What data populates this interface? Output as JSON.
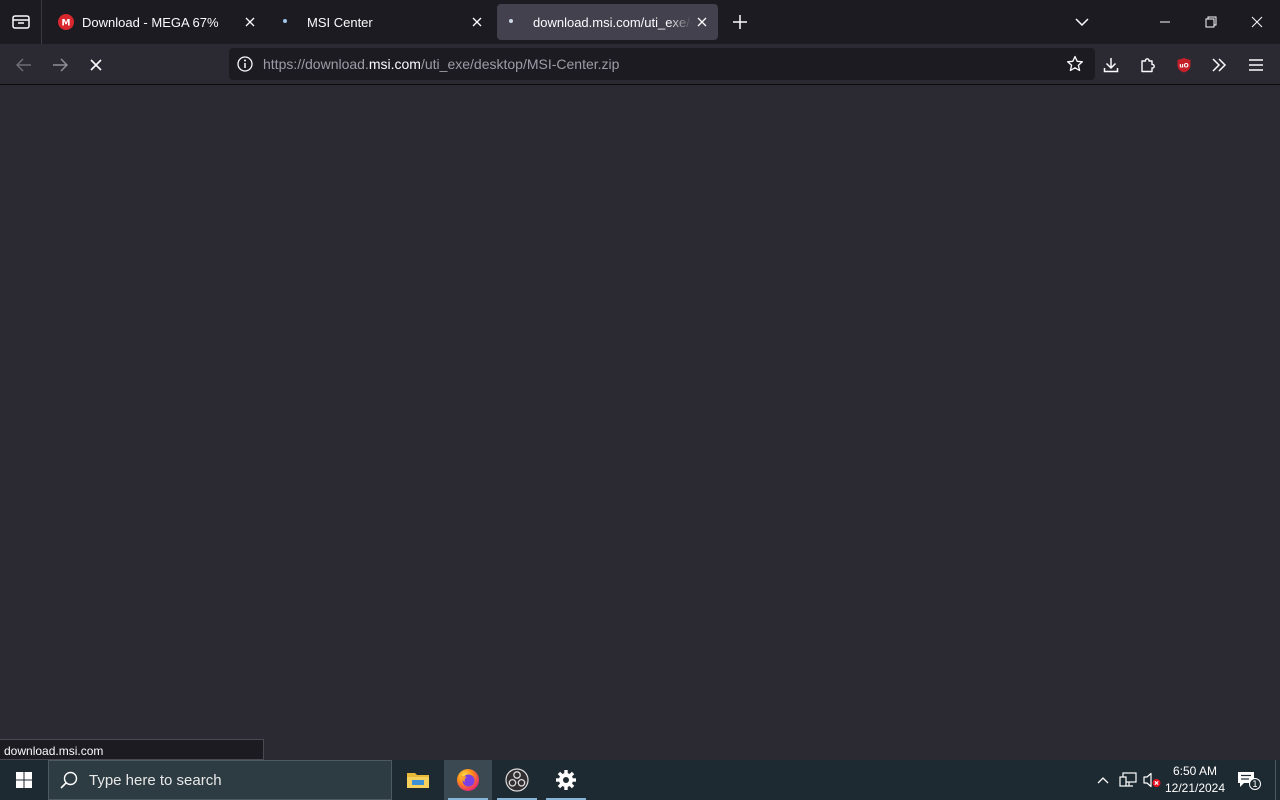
{
  "tabs": [
    {
      "title": "Download - MEGA 67%",
      "favicon": "mega-logo-icon",
      "favicon_color": "#d9272e"
    },
    {
      "title": "MSI Center",
      "favicon": "loading-dot-icon"
    },
    {
      "title": "download.msi.com/uti_exe/desktop/MSI-Center.zip",
      "favicon": "loading-dot-icon",
      "active": true
    }
  ],
  "navbar": {
    "url_prefix": "https://download.",
    "url_host": "msi.com",
    "url_path": "/uti_exe/desktop/MSI-Center.zip"
  },
  "extensions": {
    "ublock_label": "uO",
    "ublock_color": "#800000"
  },
  "status_text": "download.msi.com",
  "taskbar": {
    "search_placeholder": "Type here to search",
    "apps": [
      "file-explorer-icon",
      "firefox-icon",
      "obs-studio-icon",
      "settings-gear-icon"
    ],
    "time": "6:50 AM",
    "date": "12/21/2024",
    "notification_count": "1"
  },
  "colors": {
    "tabstrip_bg": "#1c1b22",
    "toolbar_bg": "#2b2a33",
    "active_tab_bg": "#42414d",
    "taskbar_bg": "#1e2a31"
  }
}
